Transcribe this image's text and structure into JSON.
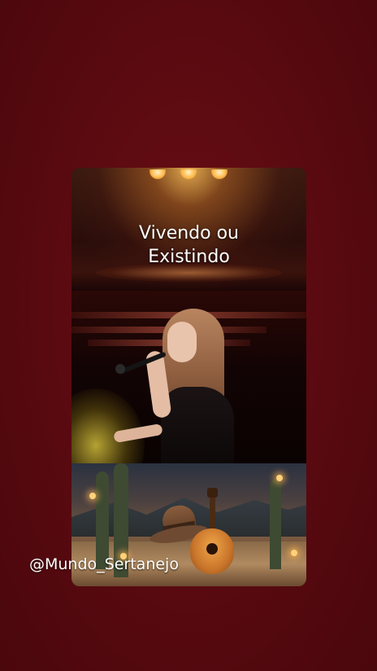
{
  "video": {
    "title_line1": "Vivendo ou",
    "title_line2": "Existindo",
    "watermark": "@Mundo_Sertanejo"
  },
  "colors": {
    "background": "#5c0a10",
    "title_text": "#ffffff",
    "watermark_text": "#ffffff"
  }
}
